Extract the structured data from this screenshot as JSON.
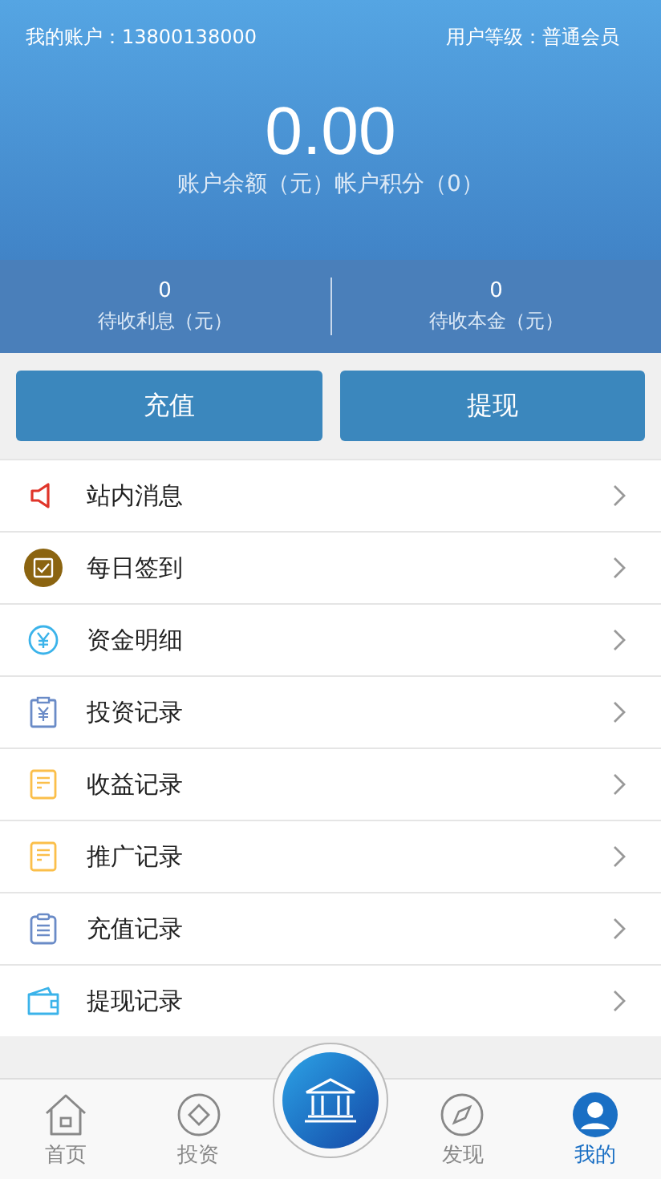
{
  "header": {
    "account_label": "我的账户：13800138000",
    "level_label": "用户等级：普通会员",
    "balance": "0.00",
    "balance_caption": "账户余额（元）帐户积分（0）",
    "stats": [
      {
        "value": "0",
        "label": "待收利息（元）"
      },
      {
        "value": "0",
        "label": "待收本金（元）"
      }
    ]
  },
  "actions": [
    "充值",
    "提现"
  ],
  "menu": [
    {
      "kind": "speaker",
      "label": "站内消息"
    },
    {
      "kind": "checkin",
      "label": "每日签到"
    },
    {
      "kind": "yen",
      "label": "资金明细"
    },
    {
      "kind": "clipboard-yen",
      "label": "投资记录"
    },
    {
      "kind": "document",
      "label": "收益记录"
    },
    {
      "kind": "document",
      "label": "推广记录"
    },
    {
      "kind": "clipboard",
      "label": "充值记录"
    },
    {
      "kind": "wallet",
      "label": "提现记录"
    }
  ],
  "tabbar": [
    {
      "kind": "home",
      "label": "首页",
      "selected": false
    },
    {
      "kind": "diamond",
      "label": "投资",
      "selected": false
    },
    {
      "kind": "center",
      "selected": false
    },
    {
      "kind": "compass",
      "label": "发现",
      "selected": false
    },
    {
      "kind": "user",
      "label": "我的",
      "selected": true
    }
  ]
}
